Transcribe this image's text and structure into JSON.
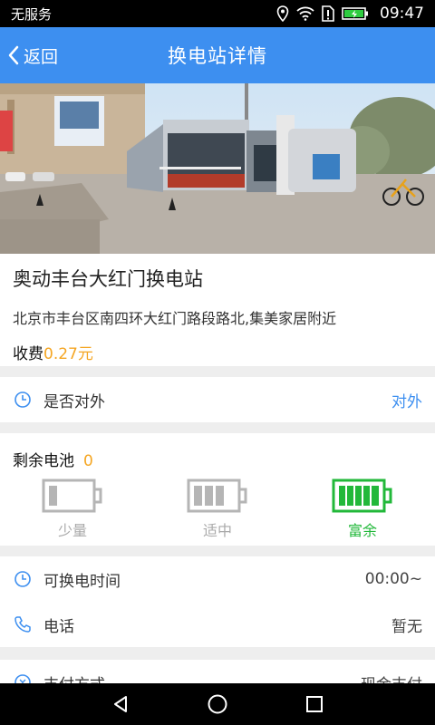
{
  "status_bar": {
    "carrier": "无服务",
    "time": "09:47"
  },
  "header": {
    "back_label": "返回",
    "title": "换电站详情"
  },
  "station": {
    "name": "奥动丰台大红门换电站",
    "address": "北京市丰台区南四环大红门路段路北,集美家居附近",
    "fee_label": "收费",
    "fee_value": "0.27元"
  },
  "public_row": {
    "label": "是否对外",
    "value": "对外"
  },
  "battery": {
    "title": "剩余电池",
    "count": "0",
    "options": [
      {
        "label": "少量",
        "color": "#b5b5b5",
        "level": "low"
      },
      {
        "label": "适中",
        "color": "#b5b5b5",
        "level": "medium"
      },
      {
        "label": "富余",
        "color": "#22b83a",
        "level": "full"
      }
    ]
  },
  "details": {
    "hours_label": "可换电时间",
    "hours_value": "00:00~",
    "phone_label": "电话",
    "phone_value": "暂无",
    "payment_label": "支付方式",
    "payment_value": "现金支付"
  },
  "colors": {
    "header": "#3d8ff0",
    "accent": "#f5a623",
    "green": "#22b83a"
  }
}
